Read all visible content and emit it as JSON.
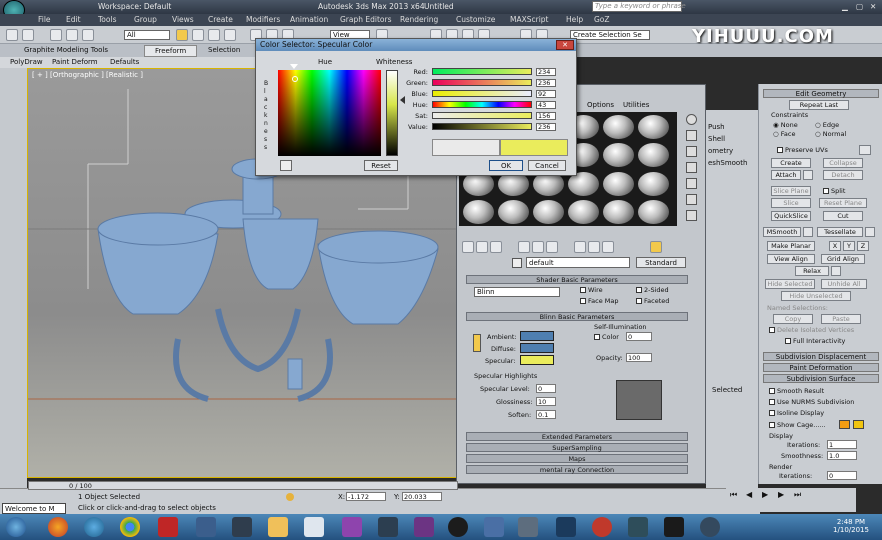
{
  "app": {
    "title": "Autodesk 3ds Max 2013 x64",
    "file": "Untitled",
    "workspace": "Workspace: Default",
    "search_placeholder": "Type a keyword or phrase"
  },
  "menu": [
    "File",
    "Edit",
    "Tools",
    "Group",
    "Views",
    "Create",
    "Modifiers",
    "Animation",
    "Graph Editors",
    "Rendering",
    "Customize",
    "MAXScript",
    "Help",
    "GoZ"
  ],
  "toolbar": {
    "selection_filter": "All",
    "view": "View",
    "selection_set": "Create Selection Se"
  },
  "ribbon": {
    "tabs": [
      "Graphite Modeling Tools",
      "Freeform",
      "Selection"
    ],
    "subtabs": [
      "PolyDraw",
      "Paint Deform",
      "Defaults"
    ]
  },
  "viewport": {
    "label": "[ + ] [Orthographic ] [Realistic ]"
  },
  "watermark": "YIHUUU.COM",
  "color_dialog": {
    "title": "Color Selector: Specular Color",
    "hue_label": "Hue",
    "whiteness_label": "Whiteness",
    "blackness_label": "B l a c k n e s s",
    "reset": "Reset",
    "ok": "OK",
    "cancel": "Cancel",
    "sliders": [
      {
        "label": "Red:",
        "value": "234"
      },
      {
        "label": "Green:",
        "value": "236"
      },
      {
        "label": "Blue:",
        "value": "92"
      },
      {
        "label": "Hue:",
        "value": "43"
      },
      {
        "label": "Sat:",
        "value": "156"
      },
      {
        "label": "Value:",
        "value": "236"
      }
    ],
    "old_color": "#eaeaea",
    "new_color": "#eaec5c"
  },
  "material_editor": {
    "menu": [
      "Options",
      "Utilities"
    ],
    "material_name": "default",
    "material_type": "Standard",
    "rollouts": {
      "shader_basic": "Shader Basic Parameters",
      "shader": "Blinn",
      "wire": "Wire",
      "two_sided": "2-Sided",
      "face_map": "Face Map",
      "faceted": "Faceted",
      "blinn_basic": "Blinn Basic Parameters",
      "self_illum": "Self-Illumination",
      "color": "Color",
      "color_value": "0",
      "ambient": "Ambient:",
      "diffuse": "Diffuse:",
      "specular": "Specular:",
      "opacity": "Opacity:",
      "opacity_value": "100",
      "specular_highlights": "Specular Highlights",
      "specular_level": "Specular Level:",
      "specular_level_value": "0",
      "glossiness": "Glossiness:",
      "glossiness_value": "10",
      "soften": "Soften:",
      "soften_value": "0.1",
      "extended": "Extended Parameters",
      "supersampling": "SuperSampling",
      "maps": "Maps",
      "mental_ray": "mental ray Connection"
    },
    "colors": {
      "ambient": "#4f7fb0",
      "diffuse": "#4f7fb0",
      "specular": "#eaec5c"
    },
    "partial_right": [
      "Push",
      "Shell",
      "ometry",
      "eshSmooth"
    ]
  },
  "command_panel": {
    "edit_geometry": "Edit Geometry",
    "repeat_last": "Repeat Last",
    "constraints": "Constraints",
    "none": "None",
    "edge": "Edge",
    "face": "Face",
    "normal": "Normal",
    "preserve_uvs": "Preserve UVs",
    "create": "Create",
    "collapse": "Collapse",
    "attach": "Attach",
    "detach": "Detach",
    "slice_plane": "Slice Plane",
    "split": "Split",
    "slice": "Slice",
    "reset_plane": "Reset Plane",
    "quickslice": "QuickSlice",
    "cut": "Cut",
    "msmooth": "MSmooth",
    "tessellate": "Tessellate",
    "make_planar": "Make Planar",
    "x": "X",
    "y": "Y",
    "z": "Z",
    "view_align": "View Align",
    "grid_align": "Grid Align",
    "relax": "Relax",
    "hide_selected": "Hide Selected",
    "unhide_all": "Unhide All",
    "hide_unselected": "Hide Unselected",
    "named_selections": "Named Selections:",
    "copy": "Copy",
    "paste": "Paste",
    "delete_isolated": "Delete Isolated Vertices",
    "full_interactivity": "Full Interactivity",
    "subdivision_displacement": "Subdivision Displacement",
    "paint_deformation": "Paint Deformation",
    "subdivision_surface": "Subdivision Surface",
    "smooth_result": "Smooth Result",
    "use_nurms": "Use NURMS Subdivision",
    "isoline_display": "Isoline Display",
    "show_cage": "Show Cage......",
    "display": "Display",
    "iterations": "Iterations:",
    "iterations_value": "1",
    "smoothness": "Smoothness:",
    "smoothness_value": "1.0",
    "render": "Render",
    "render_iterations_value": "0",
    "selected_partial": "Selected"
  },
  "status": {
    "timeline": "0 / 100",
    "selection": "1 Object Selected",
    "prompt": "Click or click-and-drag to select objects",
    "x_label": "X:",
    "x_value": "-1.172",
    "y_label": "Y:",
    "y_value": "20.033",
    "welcome": "Welcome to M"
  },
  "clock": {
    "time": "2:48 PM",
    "date": "1/10/2015"
  }
}
